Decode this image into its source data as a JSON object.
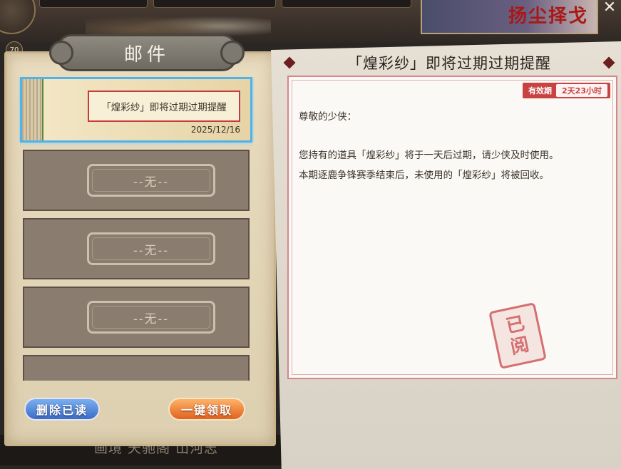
{
  "header": {
    "level": "70",
    "banner_text": "扬尘择戈",
    "close_label": "✕"
  },
  "mail_panel": {
    "title": "邮件",
    "items": [
      {
        "subject": "「煌彩纱」即将过期过期提醒",
        "date": "2025/12/16",
        "selected": true
      },
      {
        "subject": "--无--"
      },
      {
        "subject": "--无--"
      },
      {
        "subject": "--无--"
      }
    ],
    "delete_read_label": "删除已读",
    "claim_all_label": "一键领取"
  },
  "detail": {
    "title": "「煌彩纱」即将过期过期提醒",
    "validity_label": "有效期",
    "validity_value": "2天23小时",
    "greeting": "尊敬的少侠：",
    "body": [
      "您持有的道具「煌彩纱」将于一天后过期，请少侠及时使用。",
      "本期逐鹿争锋赛季结束后，未使用的「煌彩纱」将被回收。"
    ],
    "stamp_text": "已阅"
  },
  "bottom_bar": {
    "text": "画境  天驰阁  山河志"
  },
  "colors": {
    "accent_red": "#c84242",
    "selected_border": "#4fb2e8",
    "delete_button": "#3a6cc8",
    "claim_button": "#e0621e"
  }
}
